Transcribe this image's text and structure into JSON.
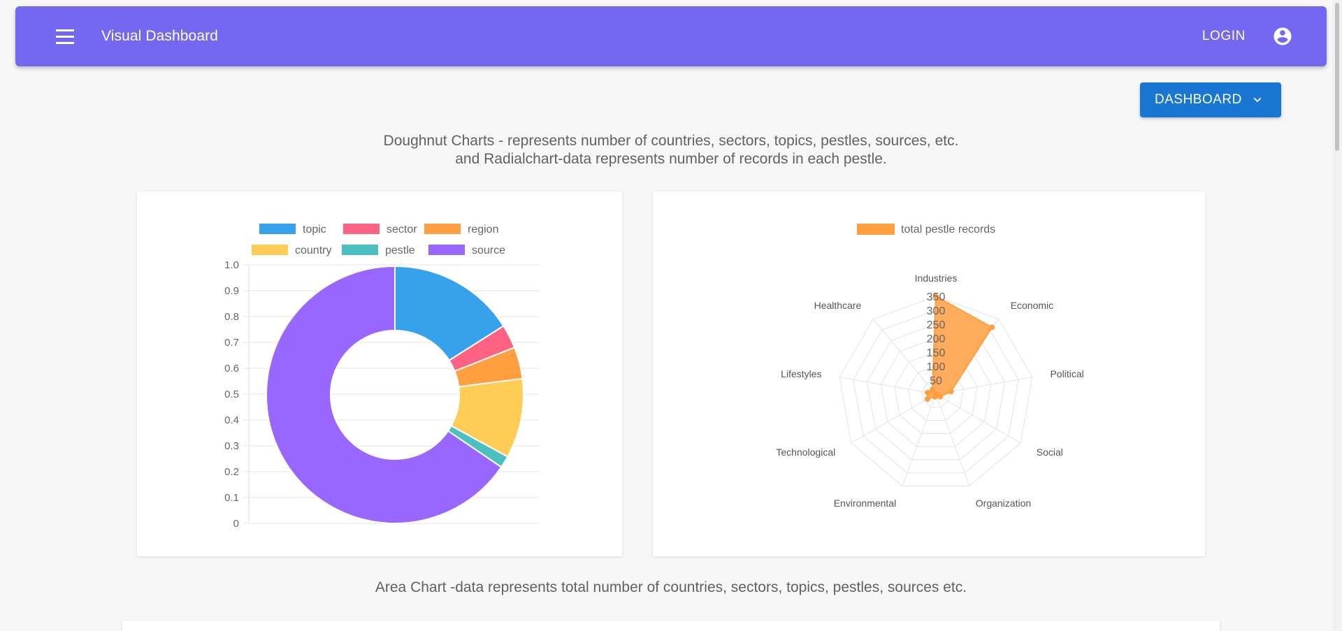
{
  "header": {
    "title": "Visual Dashboard",
    "login_label": "LOGIN"
  },
  "dashboard_button": {
    "label": "DASHBOARD"
  },
  "descriptions": {
    "doughnut_line1": "Doughnut Charts - represents number of countries, sectors, topics, pestles, sources, etc.",
    "doughnut_line2": "and Radialchart-data represents number of records in each pestle.",
    "area": "Area Chart -data represents total number of countries, sectors, topics, pestles, sources etc."
  },
  "icons": {
    "menu": "menu-icon",
    "account": "account-circle-icon",
    "dropdown": "chevron-down-icon"
  },
  "colors": {
    "appbar": "#7468f0",
    "button": "#1976d2"
  },
  "chart_data": [
    {
      "type": "pie",
      "variant": "doughnut",
      "legend_position": "top",
      "categories": [
        "topic",
        "sector",
        "region",
        "country",
        "pestle",
        "source"
      ],
      "colors": [
        "#36a2eb",
        "#ff6384",
        "#ff9f40",
        "#ffcd56",
        "#4bc0c0",
        "#9966ff"
      ],
      "values": [
        16,
        3,
        4,
        10,
        1.5,
        65.5
      ],
      "yticks": [
        "1.0",
        "0.9",
        "0.8",
        "0.7",
        "0.6",
        "0.5",
        "0.4",
        "0.3",
        "0.2",
        "0.1",
        "0"
      ],
      "ylim": [
        0,
        1
      ],
      "grid": true
    },
    {
      "type": "radar",
      "legend_position": "top",
      "series": [
        {
          "name": "total pestle records",
          "color": "#ff9f40",
          "values": [
            350,
            312,
            55,
            18,
            0,
            10,
            35,
            30,
            20
          ]
        }
      ],
      "categories": [
        "Industries",
        "Economic",
        "Political",
        "Social",
        "Organization",
        "Environmental",
        "Technological",
        "Lifestyles",
        "Healthcare"
      ],
      "rticks": [
        "350",
        "300",
        "250",
        "200",
        "150",
        "100",
        "50"
      ],
      "rlim": [
        0,
        350
      ]
    }
  ]
}
